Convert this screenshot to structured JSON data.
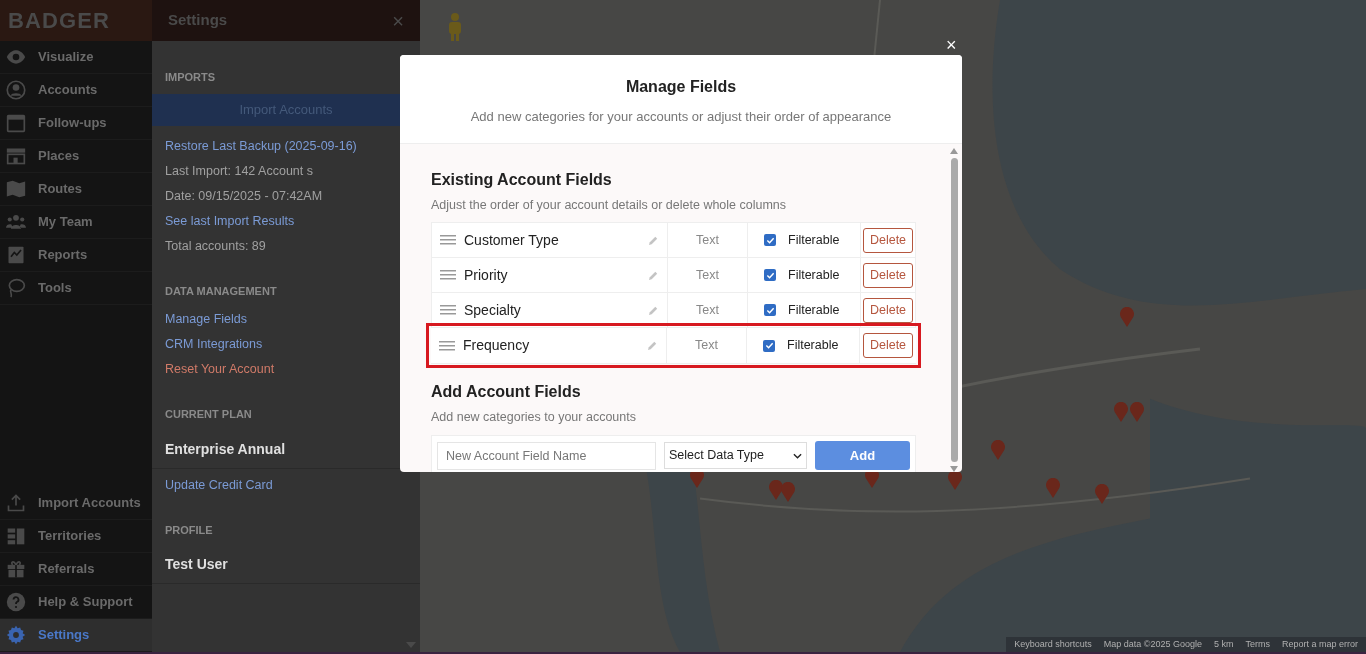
{
  "logo": "BADGER",
  "nav": {
    "top": [
      {
        "label": "Visualize",
        "selected": false
      },
      {
        "label": "Accounts",
        "selected": false
      },
      {
        "label": "Follow-ups",
        "selected": false
      },
      {
        "label": "Places",
        "selected": false
      },
      {
        "label": "Routes",
        "selected": false
      },
      {
        "label": "My Team",
        "selected": false
      },
      {
        "label": "Reports",
        "selected": false
      },
      {
        "label": "Tools",
        "selected": false
      }
    ],
    "bottom": [
      {
        "label": "Import Accounts",
        "selected": false
      },
      {
        "label": "Territories",
        "selected": false
      },
      {
        "label": "Referrals",
        "selected": false
      },
      {
        "label": "Help & Support",
        "selected": false
      },
      {
        "label": "Settings",
        "selected": true
      }
    ]
  },
  "settings": {
    "title": "Settings",
    "close": "×",
    "sections": [
      {
        "heading": "IMPORTS",
        "items": [
          {
            "kind": "button",
            "text": "Import Accounts"
          },
          {
            "kind": "link",
            "text": "Restore Last Backup (2025-09-16)"
          },
          {
            "kind": "info",
            "text": "Last Import: 142 Account s"
          },
          {
            "kind": "info",
            "text": "Date: 09/15/2025 - 07:42AM"
          },
          {
            "kind": "link",
            "text": "See last Import Results"
          },
          {
            "kind": "info",
            "text": "Total accounts: 89"
          }
        ]
      },
      {
        "heading": "DATA MANAGEMENT",
        "items": [
          {
            "kind": "link",
            "text": "Manage Fields"
          },
          {
            "kind": "link",
            "text": "CRM Integrations"
          },
          {
            "kind": "danger",
            "text": "Reset Your Account"
          }
        ]
      },
      {
        "heading": "CURRENT PLAN",
        "items": [
          {
            "kind": "title",
            "text": "Enterprise Annual"
          },
          {
            "kind": "link",
            "text": "Update Credit Card"
          }
        ]
      },
      {
        "heading": "PROFILE",
        "items": [
          {
            "kind": "title",
            "text": "Test User"
          }
        ]
      }
    ]
  },
  "map": {
    "attribution": [
      "Keyboard shortcuts",
      "Map data ©2025 Google",
      "5 km",
      "Terms",
      "Report a map error"
    ]
  },
  "modal": {
    "close": "×",
    "title": "Manage Fields",
    "subtitle": "Add new categories for your accounts or adjust their order of appearance",
    "existing": {
      "heading": "Existing Account Fields",
      "description": "Adjust the order of your account details or delete whole columns",
      "rows": [
        {
          "name": "Customer Type",
          "type": "Text",
          "filterable": true,
          "filter_label": "Filterable",
          "delete": "Delete",
          "highlighted": false
        },
        {
          "name": "Priority",
          "type": "Text",
          "filterable": true,
          "filter_label": "Filterable",
          "delete": "Delete",
          "highlighted": false
        },
        {
          "name": "Specialty",
          "type": "Text",
          "filterable": true,
          "filter_label": "Filterable",
          "delete": "Delete",
          "highlighted": false
        },
        {
          "name": "Frequency",
          "type": "Text",
          "filterable": true,
          "filter_label": "Filterable",
          "delete": "Delete",
          "highlighted": true
        }
      ]
    },
    "add": {
      "heading": "Add Account Fields",
      "description": "Add new categories to your accounts",
      "name_placeholder": "New Account Field Name",
      "type_select": "Select Data Type",
      "button": "Add"
    }
  }
}
